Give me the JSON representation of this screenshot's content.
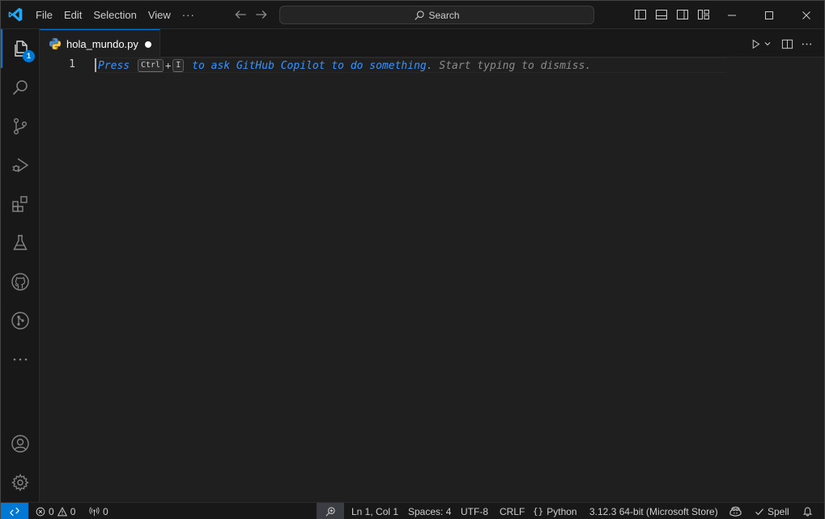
{
  "app": {
    "name": "Visual Studio Code",
    "accent_color": "#0078d4"
  },
  "menu": {
    "items": [
      "File",
      "Edit",
      "Selection",
      "View"
    ],
    "more": "···"
  },
  "search": {
    "label": "Search",
    "icon": "search-icon"
  },
  "activity_bar": {
    "items": [
      {
        "name": "explorer",
        "icon": "files-icon",
        "badge": "1",
        "active": true
      },
      {
        "name": "search",
        "icon": "search-icon"
      },
      {
        "name": "source-control",
        "icon": "source-control-icon"
      },
      {
        "name": "run-and-debug",
        "icon": "run-debug-icon"
      },
      {
        "name": "extensions",
        "icon": "extensions-icon"
      },
      {
        "name": "testing",
        "icon": "beaker-icon"
      },
      {
        "name": "github",
        "icon": "github-icon"
      },
      {
        "name": "git-graph",
        "icon": "git-graph-icon"
      },
      {
        "name": "more",
        "icon": "ellipsis-icon"
      }
    ],
    "bottom": [
      {
        "name": "accounts",
        "icon": "account-icon"
      },
      {
        "name": "manage",
        "icon": "gear-icon"
      }
    ]
  },
  "editor": {
    "tab": {
      "label": "hola_mundo.py",
      "icon": "python-icon",
      "modified": true
    },
    "line_number": "1",
    "hint": {
      "press": "Press",
      "key1": "Ctrl",
      "plus": "+",
      "key2": "I",
      "link": " to ask GitHub Copilot to do something",
      "rest": ". Start typing to dismiss."
    }
  },
  "status_bar": {
    "errors": "0",
    "warnings": "0",
    "ports": "0",
    "position": "Ln 1, Col 1",
    "spaces": "Spaces: 4",
    "encoding": "UTF-8",
    "eol": "CRLF",
    "language": "Python",
    "interpreter": "3.12.3 64-bit (Microsoft Store)",
    "spell": "Spell"
  }
}
